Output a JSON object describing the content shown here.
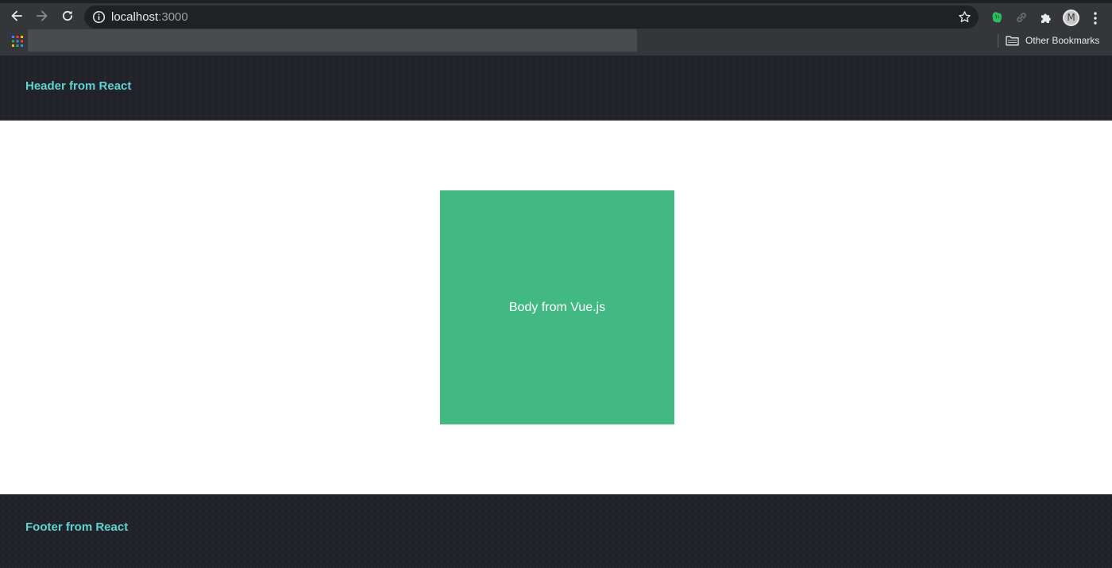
{
  "browser": {
    "url_host": "localhost",
    "url_port": ":3000",
    "bookmarks_bar": {
      "other_bookmarks_label": "Other Bookmarks"
    },
    "profile_initial": "M",
    "icons": [
      "back-arrow-icon",
      "forward-arrow-icon",
      "reload-icon",
      "info-icon",
      "star-icon",
      "evernote-icon",
      "link-icon",
      "puzzle-icon",
      "profile-avatar",
      "more-vertical-icon",
      "apps-grid-icon",
      "folder-icon"
    ]
  },
  "page": {
    "header": {
      "text": "Header from React"
    },
    "body": {
      "text": "Body from Vue.js"
    },
    "footer": {
      "text": "Footer from React"
    }
  },
  "colors": {
    "chrome_bg": "#35363a",
    "omnibox_bg": "#202124",
    "react_bg": "#222328",
    "react_text": "#5fd3d3",
    "vue_green": "#42b983"
  }
}
